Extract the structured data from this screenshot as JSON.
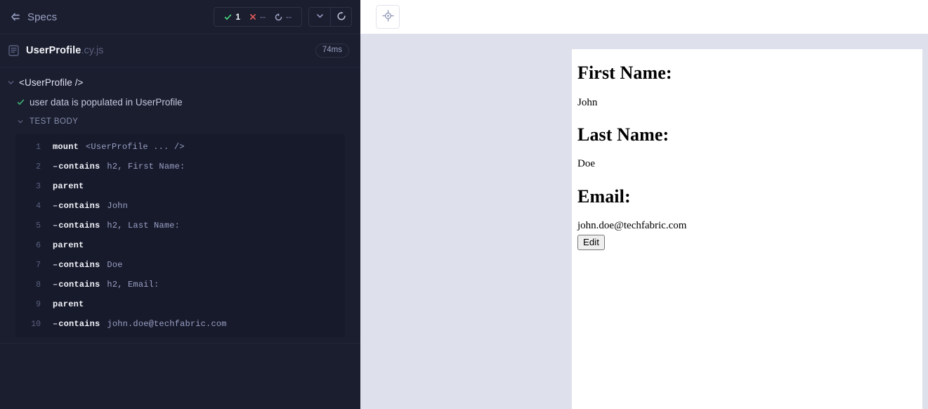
{
  "reporter": {
    "header": {
      "back_icon": "arrow-left-lines-icon",
      "specs_label": "Specs",
      "stats": [
        {
          "key": "passed",
          "icon": "check-icon",
          "value": "1",
          "color": "#4ADE80"
        },
        {
          "key": "failed",
          "icon": "x-icon",
          "value": "--",
          "color": "#E45C5C"
        },
        {
          "key": "pending",
          "icon": "pending-circle-icon",
          "value": "--",
          "color": "#9AA0C4"
        }
      ],
      "buttons": [
        {
          "name": "chevron-down-button",
          "icon": "chevron-down-icon"
        },
        {
          "name": "restart-button",
          "icon": "restart-icon"
        }
      ]
    },
    "spec": {
      "file_icon": "spec-file-icon",
      "name": "UserProfile",
      "ext": ".cy.js",
      "duration": "74ms"
    },
    "suite": {
      "caret": "chevron-down-icon",
      "title": "<UserProfile />"
    },
    "test": {
      "status_icon": "check-icon",
      "title": "user data is populated in UserProfile"
    },
    "test_body_section": {
      "caret": "chevron-down-icon",
      "title": "TEST BODY"
    },
    "commands": [
      {
        "num": "1",
        "child": false,
        "name": "mount",
        "args": "<UserProfile ... />"
      },
      {
        "num": "2",
        "child": true,
        "name": "contains",
        "args": "h2, First Name:"
      },
      {
        "num": "3",
        "child": false,
        "name": "parent",
        "args": ""
      },
      {
        "num": "4",
        "child": true,
        "name": "contains",
        "args": "John"
      },
      {
        "num": "5",
        "child": true,
        "name": "contains",
        "args": "h2, Last Name:"
      },
      {
        "num": "6",
        "child": false,
        "name": "parent",
        "args": ""
      },
      {
        "num": "7",
        "child": true,
        "name": "contains",
        "args": "Doe"
      },
      {
        "num": "8",
        "child": true,
        "name": "contains",
        "args": "h2, Email:"
      },
      {
        "num": "9",
        "child": false,
        "name": "parent",
        "args": ""
      },
      {
        "num": "10",
        "child": true,
        "name": "contains",
        "args": "john.doe@techfabric.com"
      }
    ]
  },
  "runner": {
    "toolbar": {
      "playground_icon": "selector-playground-crosshair-icon"
    },
    "app": {
      "fields": [
        {
          "heading": "First Name:",
          "value": "John"
        },
        {
          "heading": "Last Name:",
          "value": "Doe"
        },
        {
          "heading": "Email:",
          "value": "john.doe@techfabric.com"
        }
      ],
      "edit_button_label": "Edit"
    }
  },
  "colors": {
    "reporter_bg": "#1B1E2E",
    "command_bg": "#171A2B",
    "preview_bg": "#DEE1EB",
    "pass_green": "#4ADE80",
    "fail_red": "#E45C5C"
  }
}
